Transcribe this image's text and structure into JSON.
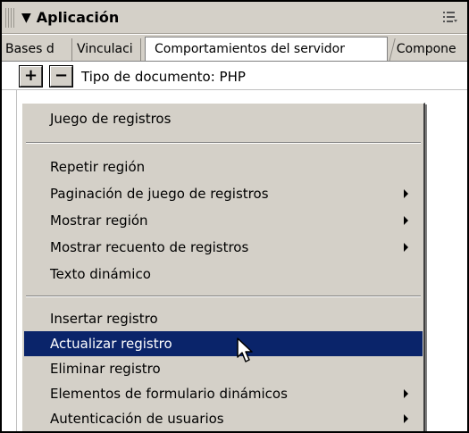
{
  "panel": {
    "title": "Aplicación",
    "collapse_icon": "triangle-down-icon",
    "options_icon": "panel-options-icon"
  },
  "tabs": [
    {
      "label": "Bases de datos",
      "visible_text": "Bases d"
    },
    {
      "label": "Vinculaciones",
      "visible_text": "Vinculaci"
    },
    {
      "label": "Comportamientos del servidor",
      "visible_text": "Comportamientos del servidor",
      "active": true
    },
    {
      "label": "Componentes",
      "visible_text": "Compone"
    }
  ],
  "toolbar": {
    "add_label": "+",
    "remove_label": "−",
    "document_type": "Tipo de documento: PHP"
  },
  "menu": {
    "groups": [
      [
        {
          "label": "Juego de registros",
          "submenu": false
        }
      ],
      [
        {
          "label": "Repetir región",
          "submenu": false
        },
        {
          "label": "Paginación de juego de registros",
          "submenu": true
        },
        {
          "label": "Mostrar región",
          "submenu": true
        },
        {
          "label": "Mostrar recuento de registros",
          "submenu": true
        },
        {
          "label": "Texto dinámico",
          "submenu": false
        }
      ],
      [
        {
          "label": "Insertar registro",
          "submenu": false
        },
        {
          "label": "Actualizar registro",
          "submenu": false,
          "selected": true
        },
        {
          "label": "Eliminar registro",
          "submenu": false
        },
        {
          "label": "Elementos de formulario dinámicos",
          "submenu": true
        },
        {
          "label": "Autenticación de usuarios",
          "submenu": true
        }
      ]
    ],
    "selected_color": "#0a246a"
  },
  "colors": {
    "chrome": "#d4d0c8",
    "highlight": "#0a246a",
    "text": "#000000"
  }
}
